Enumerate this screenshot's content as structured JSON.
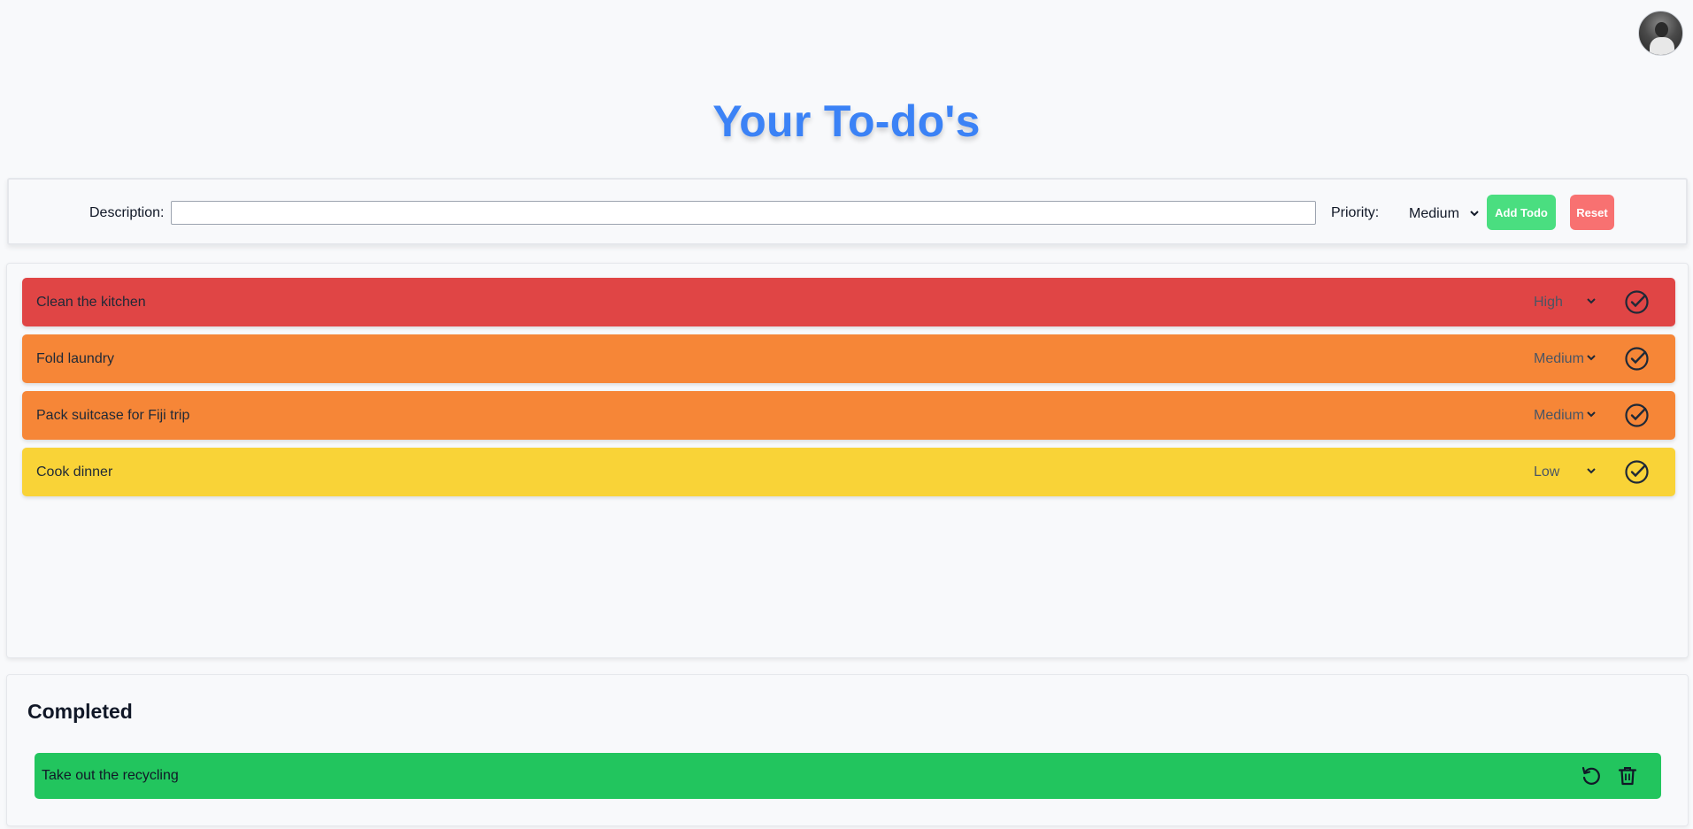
{
  "header": {
    "title": "Your To-do's"
  },
  "add_form": {
    "description_label": "Description:",
    "description_value": "",
    "priority_label": "Priority:",
    "priority_value": "Medium",
    "add_button": "Add Todo",
    "reset_button": "Reset"
  },
  "todos": [
    {
      "text": "Clean the kitchen",
      "priority": "High",
      "color": "#e04545"
    },
    {
      "text": "Fold laundry",
      "priority": "Medium",
      "color": "#f68637"
    },
    {
      "text": "Pack suitcase for Fiji trip",
      "priority": "Medium",
      "color": "#f68637"
    },
    {
      "text": "Cook dinner",
      "priority": "Low",
      "color": "#f9d337"
    }
  ],
  "completed": {
    "title": "Completed",
    "items": [
      {
        "text": "Take out the recycling",
        "color": "#22c55e"
      }
    ]
  },
  "colors": {
    "title": "#3b82f6",
    "add_button": "#4ade80",
    "reset_button": "#f87171"
  }
}
